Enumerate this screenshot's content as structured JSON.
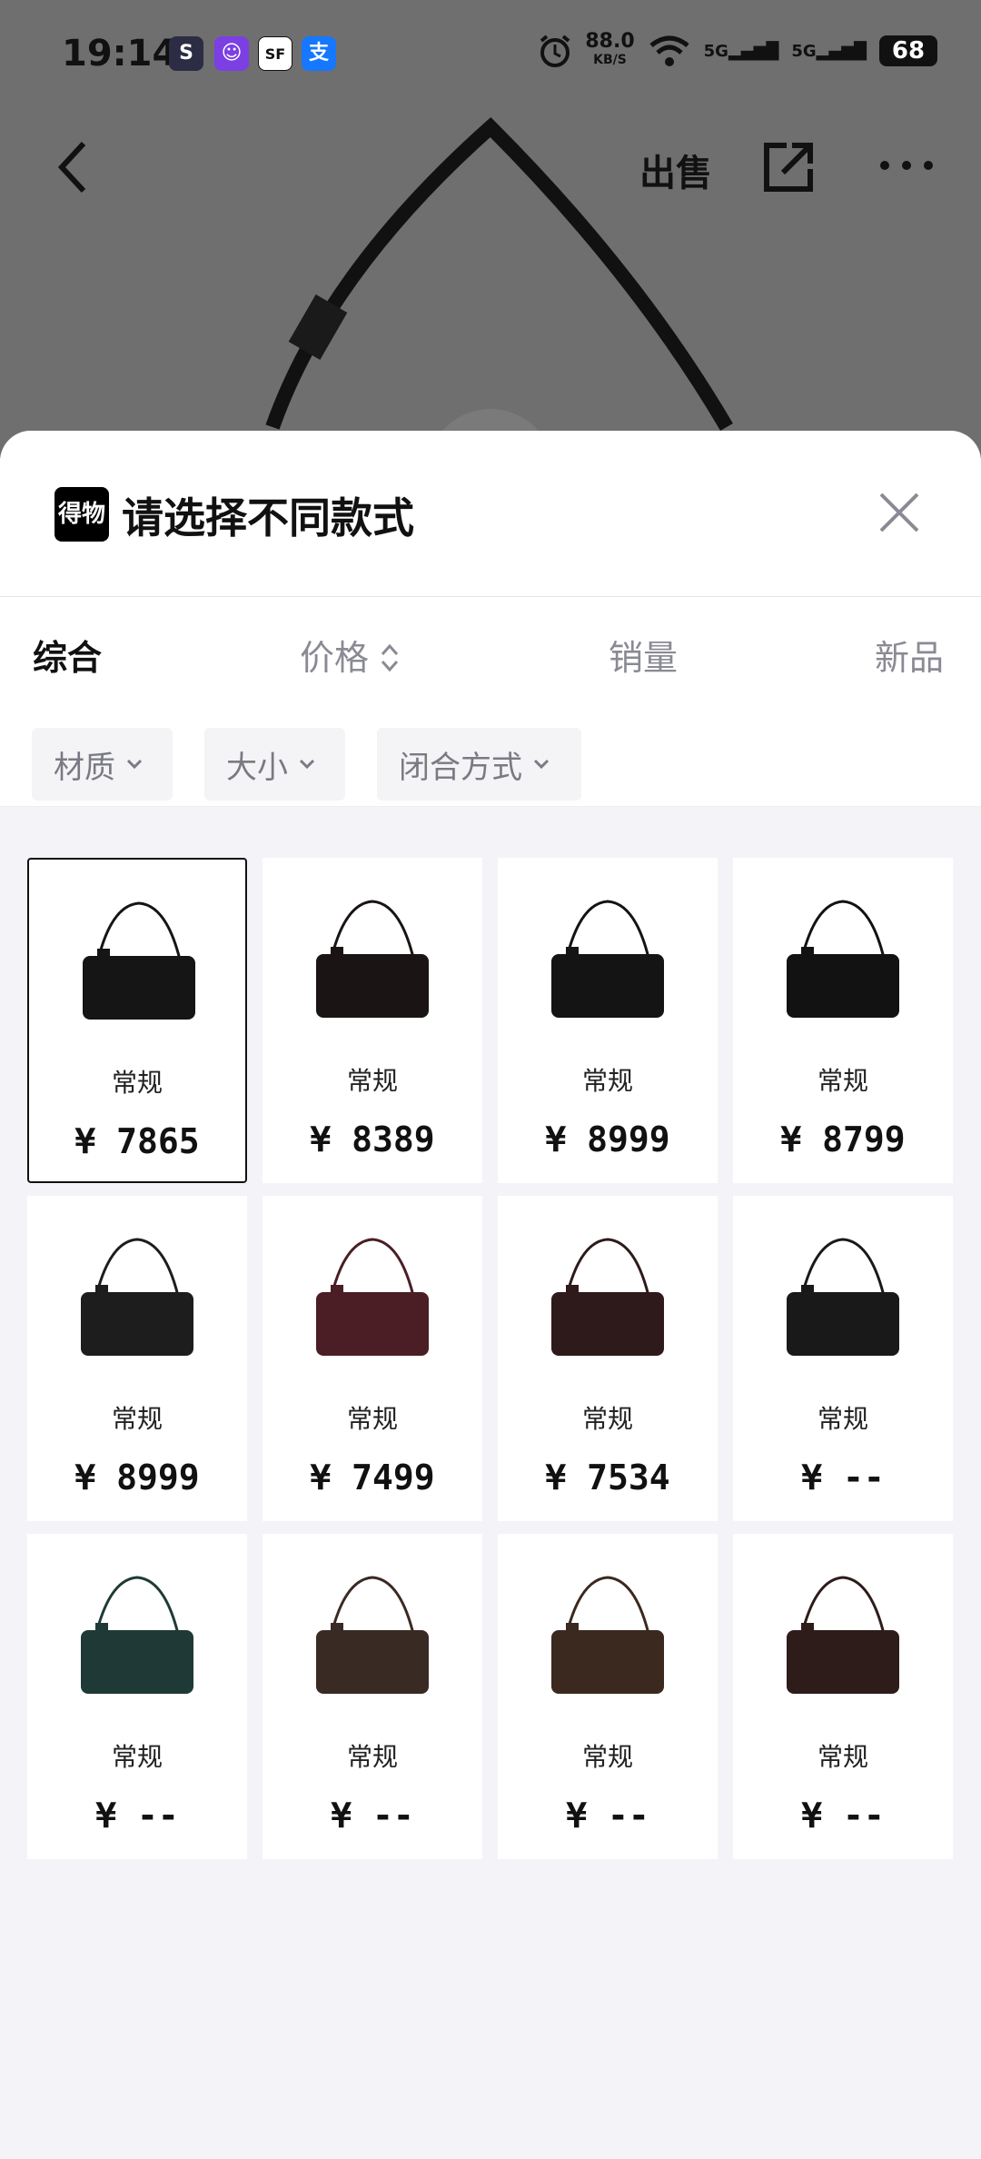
{
  "status_bar": {
    "time": "19:14",
    "net_speed": "88.0",
    "net_unit": "KB/S",
    "signal1": "5G",
    "signal2": "5G",
    "battery": "68",
    "apps": [
      {
        "name": "app-s-icon",
        "color": "#2c2c44",
        "glyph": "S"
      },
      {
        "name": "app-cat-icon",
        "color": "#7b3fe4",
        "glyph": "☺"
      },
      {
        "name": "sf-express-icon",
        "color": "#ffffff",
        "glyph": "SF"
      },
      {
        "name": "alipay-icon",
        "color": "#1677ff",
        "glyph": "支"
      }
    ]
  },
  "topbar": {
    "sell_label": "出售"
  },
  "sheet": {
    "logo_text": "得物",
    "title": "请选择不同款式",
    "sort_tabs": [
      "综合",
      "价格",
      "销量",
      "新品"
    ],
    "filters": [
      "材质",
      "大小",
      "闭合方式"
    ]
  },
  "products": [
    {
      "spec": "常规",
      "price": "¥ 7865",
      "color": "#151515",
      "selected": true
    },
    {
      "spec": "常规",
      "price": "¥ 8389",
      "color": "#1a1414"
    },
    {
      "spec": "常规",
      "price": "¥ 8999",
      "color": "#141414"
    },
    {
      "spec": "常规",
      "price": "¥ 8799",
      "color": "#121212"
    },
    {
      "spec": "常规",
      "price": "¥ 8999",
      "color": "#1d1d1d"
    },
    {
      "spec": "常规",
      "price": "¥ 7499",
      "color": "#4a1e24"
    },
    {
      "spec": "常规",
      "price": "¥ 7534",
      "color": "#2e1a1a"
    },
    {
      "spec": "常规",
      "price": "¥ --",
      "color": "#191919"
    },
    {
      "spec": "常规",
      "price": "¥ --",
      "color": "#1f3a36"
    },
    {
      "spec": "常规",
      "price": "¥ --",
      "color": "#3a2a24"
    },
    {
      "spec": "常规",
      "price": "¥ --",
      "color": "#3b281e"
    },
    {
      "spec": "常规",
      "price": "¥ --",
      "color": "#2e1c1a"
    }
  ]
}
